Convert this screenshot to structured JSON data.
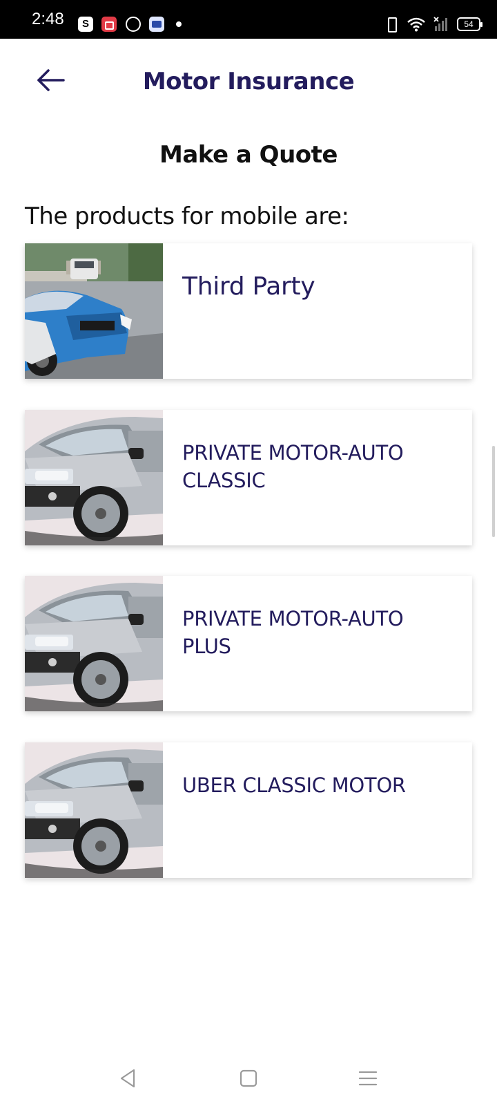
{
  "status_bar": {
    "time": "2:48",
    "app_icon_s": "S",
    "battery": "54",
    "icons": [
      "s-app-icon",
      "screen-record-icon",
      "circle-app-icon",
      "photo-app-icon",
      "notification-dot",
      "vibrate-icon",
      "wifi-icon",
      "signal-icon",
      "battery-icon"
    ]
  },
  "header": {
    "title": "Motor Insurance",
    "back_icon": "arrow-left-icon"
  },
  "page": {
    "heading": "Make a Quote",
    "intro": "The products for mobile are:"
  },
  "products": [
    {
      "label": "Third Party",
      "image": "crashed-blue-car"
    },
    {
      "label": "PRIVATE MOTOR-AUTO CLASSIC",
      "image": "silver-suv"
    },
    {
      "label": "PRIVATE MOTOR-AUTO PLUS",
      "image": "silver-suv"
    },
    {
      "label": "UBER CLASSIC MOTOR",
      "image": "silver-suv"
    }
  ],
  "nav": {
    "icons": [
      "back-nav-icon",
      "home-nav-icon",
      "menu-nav-icon"
    ]
  },
  "colors": {
    "brand_navy": "#231c5d",
    "status_bar": "#000000",
    "background": "#ffffff"
  }
}
